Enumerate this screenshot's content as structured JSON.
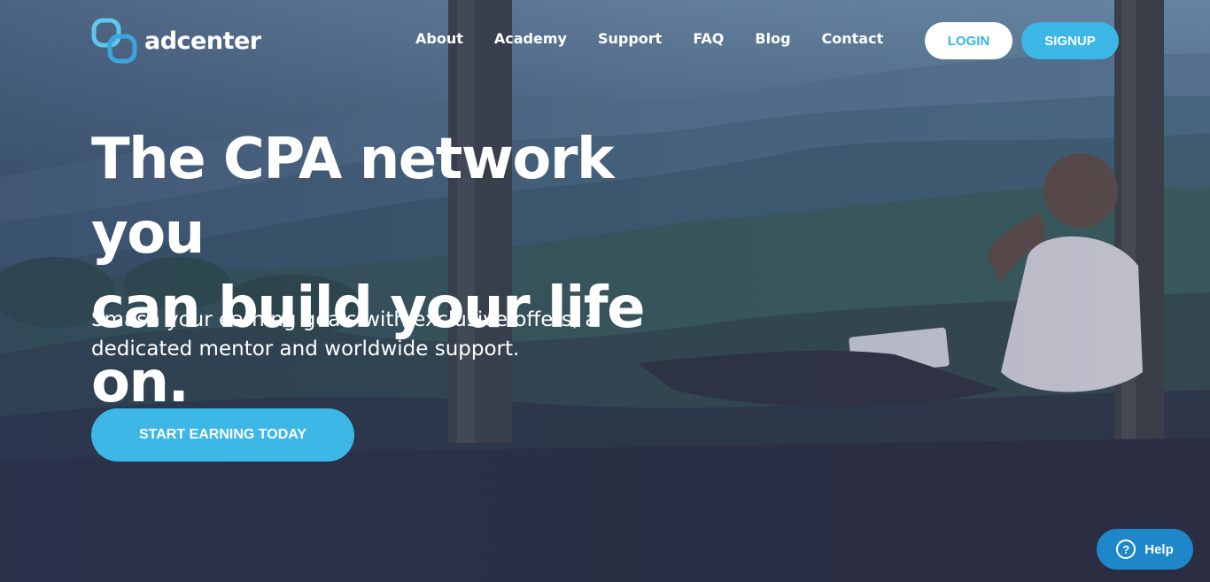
{
  "brand": {
    "name": "adcenter",
    "accent_color": "#3cb7e6",
    "logo_icon": "interlocking-rings-logo"
  },
  "nav": {
    "items": [
      {
        "label": "About"
      },
      {
        "label": "Academy"
      },
      {
        "label": "Support"
      },
      {
        "label": "FAQ"
      },
      {
        "label": "Blog"
      },
      {
        "label": "Contact"
      }
    ]
  },
  "auth": {
    "login_label": "LOGIN",
    "signup_label": "SIGNUP"
  },
  "hero": {
    "headline_line1": "The CPA network you",
    "headline_line2": "can build your life on.",
    "subtext_line1": "Smash your earning goals with exclusive offers, a",
    "subtext_line2": "dedicated mentor and worldwide support.",
    "cta_label": "START EARNING TODAY",
    "background": "hillside-man-with-laptop-photo"
  },
  "help_widget": {
    "label": "Help",
    "icon": "question-circle-icon",
    "color": "#1d87c9"
  }
}
